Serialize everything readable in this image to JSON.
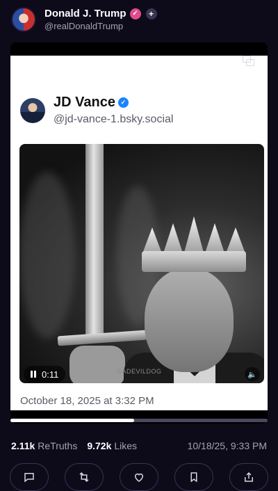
{
  "post": {
    "author": {
      "display_name": "Donald J. Trump",
      "handle": "@realDonaldTrump"
    },
    "media_card": {
      "author_name": "JD Vance",
      "author_handle": "@jd-vance-1.bsky.social",
      "video_time": "0:11",
      "watermark": "GADEVILDOG",
      "date": "October 18, 2025 at 3:32 PM"
    },
    "progress_fraction": 0.48,
    "stats": {
      "retruths_count": "2.11k",
      "retruths_label": "ReTruths",
      "likes_count": "9.72k",
      "likes_label": "Likes",
      "timestamp": "10/18/25, 9:33 PM"
    }
  },
  "icons": [
    "verified-badge-icon",
    "plus-icon",
    "copy-icon",
    "pause-icon",
    "volume-icon",
    "reply-icon",
    "retruth-icon",
    "like-icon",
    "bookmark-icon",
    "share-icon"
  ],
  "colors": {
    "background": "#0d0a1a",
    "verified": "#e04b8c",
    "card_verified": "#1a84ff"
  }
}
